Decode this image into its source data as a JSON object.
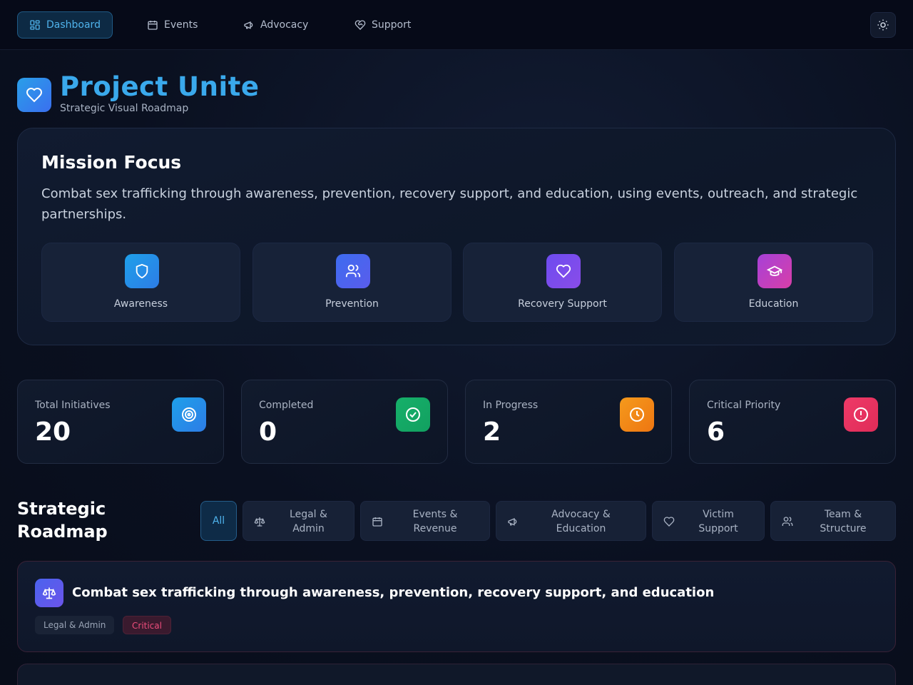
{
  "nav": {
    "items": [
      {
        "label": "Dashboard",
        "icon": "dashboard-icon",
        "active": true
      },
      {
        "label": "Events",
        "icon": "calendar-icon",
        "active": false
      },
      {
        "label": "Advocacy",
        "icon": "megaphone-icon",
        "active": false
      },
      {
        "label": "Support",
        "icon": "heart-handshake-icon",
        "active": false
      }
    ],
    "theme_toggle_icon": "sun-icon"
  },
  "header": {
    "title": "Project Unite",
    "subtitle": "Strategic Visual Roadmap",
    "logo_icon": "heart-icon"
  },
  "mission": {
    "title": "Mission Focus",
    "text": "Combat sex trafficking through awareness, prevention, recovery support, and education, using events, outreach, and strategic partnerships.",
    "pillars": [
      {
        "label": "Awareness",
        "icon": "shield-icon",
        "color": "#1e8fe6"
      },
      {
        "label": "Prevention",
        "icon": "users-icon",
        "color": "#4a66ee"
      },
      {
        "label": "Recovery Support",
        "icon": "heart-icon",
        "color": "#7a4cf0"
      },
      {
        "label": "Education",
        "icon": "graduation-cap-icon",
        "color": "#c23fc4"
      }
    ]
  },
  "stats": [
    {
      "label": "Total Initiatives",
      "value": "20",
      "icon": "target-icon",
      "color": "#1e8fe6"
    },
    {
      "label": "Completed",
      "value": "0",
      "icon": "check-circle-icon",
      "color": "#16a866"
    },
    {
      "label": "In Progress",
      "value": "2",
      "icon": "clock-icon",
      "color": "#f08a16"
    },
    {
      "label": "Critical Priority",
      "value": "6",
      "icon": "alert-circle-icon",
      "color": "#e8325f"
    }
  ],
  "roadmap": {
    "title": "Strategic Roadmap",
    "filters": [
      {
        "label": "All",
        "active": true
      },
      {
        "label": "Legal &\nAdmin",
        "icon": "scale-icon"
      },
      {
        "label": "Events &\nRevenue",
        "icon": "calendar-icon"
      },
      {
        "label": "Advocacy &\nEducation",
        "icon": "megaphone-icon"
      },
      {
        "label": "Victim\nSupport",
        "icon": "heart-icon"
      },
      {
        "label": "Team &\nStructure",
        "icon": "users-icon"
      }
    ],
    "initiatives": [
      {
        "title": "Combat sex trafficking through awareness, prevention, recovery support, and education",
        "category": "Legal & Admin",
        "priority": "Critical",
        "icon": "scale-icon"
      }
    ]
  }
}
